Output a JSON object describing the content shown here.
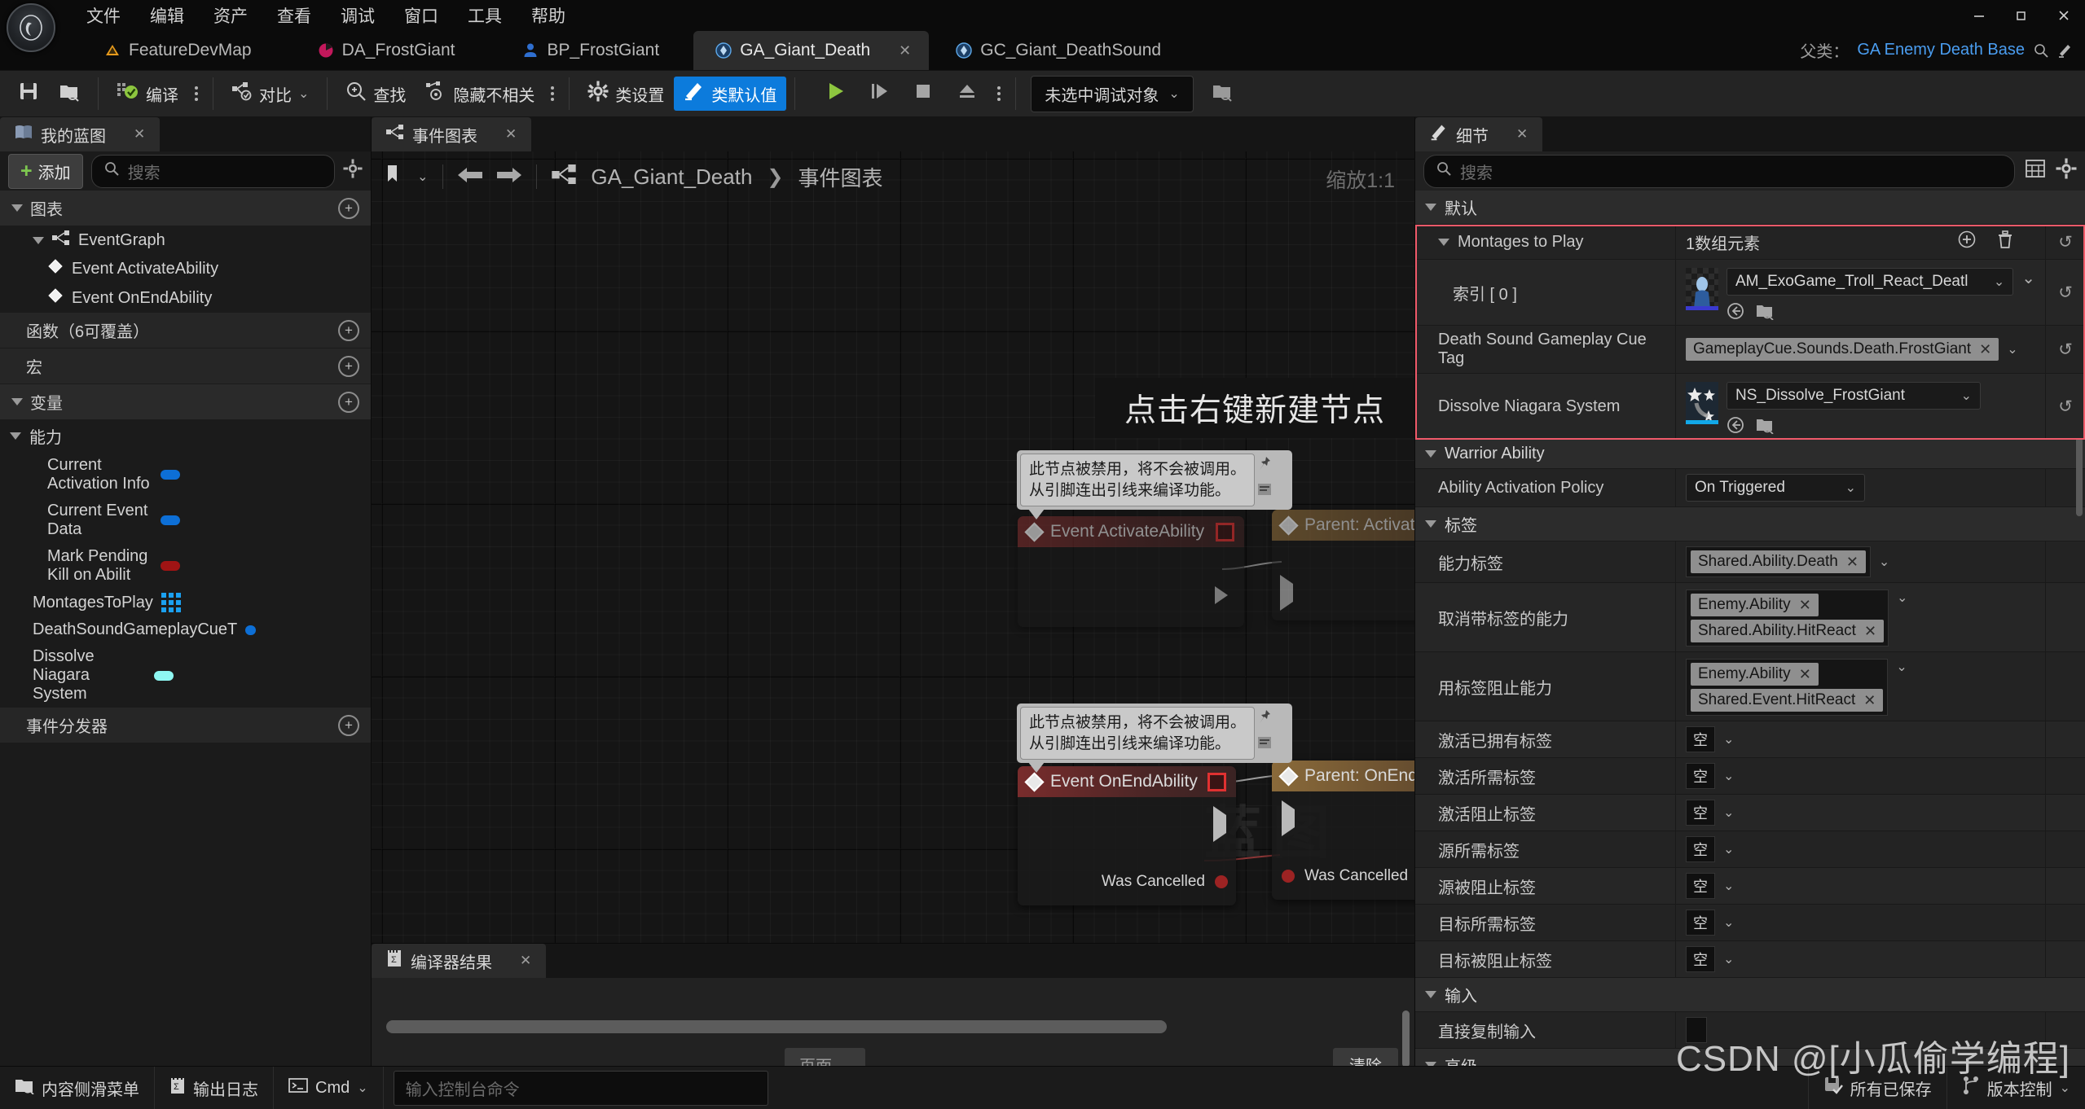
{
  "menu": {
    "items": [
      "文件",
      "编辑",
      "资产",
      "查看",
      "调试",
      "窗口",
      "工具",
      "帮助"
    ],
    "window_minimize": "—",
    "window_restore": "❐",
    "window_close": "✕"
  },
  "tabs": [
    {
      "label": "FeatureDevMap",
      "icon": "level-icon",
      "active": false,
      "closable": false
    },
    {
      "label": "DA_FrostGiant",
      "icon": "dataasset-icon",
      "active": false,
      "closable": false
    },
    {
      "label": "BP_FrostGiant",
      "icon": "blueprint-icon",
      "active": false,
      "closable": false
    },
    {
      "label": "GA_Giant_Death",
      "icon": "gameplayability-icon",
      "active": true,
      "closable": true,
      "close_label": "✕"
    },
    {
      "label": "GC_Giant_DeathSound",
      "icon": "gameplaycue-icon",
      "active": false,
      "closable": false
    }
  ],
  "parent_class": {
    "label": "父类：",
    "value": "GA Enemy Death Base"
  },
  "toolbar": {
    "save_icon": "save-icon",
    "browse_icon": "browse-content-icon",
    "compile_label": "编译",
    "diff_label": "对比",
    "find_label": "查找",
    "hide_unrelated_label": "隐藏不相关",
    "class_settings_label": "类设置",
    "class_defaults_label": "类默认值",
    "play_icon": "play-icon",
    "step_icon": "step-icon",
    "stop_icon": "stop-icon",
    "eject_icon": "eject-icon",
    "debug_object": "未选中调试对象"
  },
  "my_blueprint": {
    "tab_label": "我的蓝图",
    "tab_close": "✕",
    "add_label": "添加",
    "search_placeholder": "搜索",
    "settings_icon": "gear-icon",
    "sections": [
      {
        "name": "图表",
        "has_add": true,
        "items": [
          {
            "label": "EventGraph",
            "type": "graph",
            "depth": 0
          },
          {
            "label": "Event ActivateAbility",
            "type": "event",
            "depth": 1
          },
          {
            "label": "Event OnEndAbility",
            "type": "event",
            "depth": 1
          }
        ]
      },
      {
        "name": "函数（6可覆盖）",
        "has_add": true,
        "items": []
      },
      {
        "name": "宏",
        "has_add": true,
        "items": []
      },
      {
        "name": "变量",
        "has_add": true,
        "subgroup": "能力",
        "items": [
          {
            "label": "Current Activation Info",
            "pin": "#0d6fd6",
            "kind": "pill",
            "depth": 2
          },
          {
            "label": "Current Event Data",
            "pin": "#0d6fd6",
            "kind": "pill",
            "depth": 2
          },
          {
            "label": "Mark Pending Kill on Abilit",
            "pin": "#a01414",
            "kind": "pill",
            "depth": 2
          },
          {
            "label": "MontagesToPlay",
            "pin": "#1ba0f0",
            "kind": "array",
            "depth": 1
          },
          {
            "label": "DeathSoundGameplayCueT",
            "pin": "#0d6fd6",
            "kind": "pill",
            "depth": 1
          },
          {
            "label": "Dissolve Niagara System",
            "pin": "#8ef7f2",
            "kind": "pill",
            "depth": 1
          }
        ]
      },
      {
        "name": "事件分发器",
        "has_add": true,
        "items": []
      }
    ]
  },
  "graph": {
    "tab_label": "事件图表",
    "tab_close": "✕",
    "breadcrumb": [
      "GA_Giant_Death",
      "事件图表"
    ],
    "breadcrumb_sep": "❯",
    "zoom_label": "缩放1:1",
    "watermark": "蓝图",
    "hint_banner": "点击右键新建节点",
    "comment_text": "此节点被禁用，将不会被调用。\n从引脚连出引线来编译功能。",
    "nodes": [
      {
        "title": "Event ActivateAbility",
        "kind": "event",
        "disabled": true
      },
      {
        "title": "Parent: ActivateAbility",
        "kind": "parent",
        "disabled": true
      },
      {
        "title": "Event OnEndAbility",
        "kind": "event",
        "disabled": false,
        "out_pin": "Was Cancelled"
      },
      {
        "title": "Parent: OnEndAbility",
        "kind": "parent",
        "disabled": false,
        "in_pin": "Was Cancelled"
      }
    ]
  },
  "compiler": {
    "tab_label": "编译器结果",
    "tab_close": "✕",
    "page_label": "页面",
    "clear_label": "清除"
  },
  "details": {
    "tab_label": "细节",
    "tab_close": "✕",
    "search_placeholder": "搜索",
    "grid_icon": "column-view-icon",
    "settings_icon": "gear-icon",
    "categories": [
      {
        "name": "默认",
        "rows": [
          {
            "label": "Montages to Play",
            "type": "array-header",
            "value": "1数组元素",
            "add_icon": "plus-circle-icon",
            "delete_icon": "trash-icon",
            "reset": "↺",
            "expandable": true
          },
          {
            "label": "索引 [ 0 ]",
            "type": "asset",
            "value": "AM_ExoGame_Troll_React_Deatl",
            "thumb_bar": "#3a3ad0",
            "indent": true,
            "reset": "↺",
            "extra_chevron": "⌄"
          },
          {
            "label": "Death Sound Gameplay Cue Tag",
            "type": "tag",
            "tags": [
              "GameplayCue.Sounds.Death.FrostGiant"
            ],
            "reset": "↺"
          },
          {
            "label": "Dissolve Niagara System",
            "type": "asset",
            "value": "NS_Dissolve_FrostGiant",
            "thumb_bar": "#12a8e8",
            "thumb_icon": "niagara-stars-icon",
            "reset": "↺"
          }
        ]
      },
      {
        "name": "Warrior Ability",
        "rows": [
          {
            "label": "Ability Activation Policy",
            "type": "select",
            "value": "On Triggered"
          }
        ]
      },
      {
        "name": "标签",
        "rows": [
          {
            "label": "能力标签",
            "type": "tag",
            "tags": [
              "Shared.Ability.Death"
            ]
          },
          {
            "label": "取消带标签的能力",
            "type": "tag",
            "tags": [
              "Enemy.Ability",
              "Shared.Ability.HitReact"
            ]
          },
          {
            "label": "用标签阻止能力",
            "type": "tag",
            "tags": [
              "Enemy.Ability",
              "Shared.Event.HitReact"
            ]
          },
          {
            "label": "激活已拥有标签",
            "type": "empty",
            "value": "空"
          },
          {
            "label": "激活所需标签",
            "type": "empty",
            "value": "空"
          },
          {
            "label": "激活阻止标签",
            "type": "empty",
            "value": "空"
          },
          {
            "label": "源所需标签",
            "type": "empty",
            "value": "空"
          },
          {
            "label": "源被阻止标签",
            "type": "empty",
            "value": "空"
          },
          {
            "label": "目标所需标签",
            "type": "empty",
            "value": "空"
          },
          {
            "label": "目标被阻止标签",
            "type": "empty",
            "value": "空"
          }
        ]
      },
      {
        "name": "输入",
        "rows": [
          {
            "label": "直接复制输入",
            "type": "checkbox"
          }
        ]
      },
      {
        "name": "高级",
        "rows": []
      }
    ]
  },
  "statusbar": {
    "content_drawer": "内容侧滑菜单",
    "output_log": "输出日志",
    "cmd_label": "Cmd",
    "cmd_placeholder": "输入控制台命令",
    "all_saved": "所有已保存",
    "source_control": "版本控制"
  },
  "watermark": "CSDN @[小瓜偷学编程]",
  "colors": {
    "accent_blue": "#0c7bdc",
    "link_blue": "#4a9df0",
    "highlight_red": "#f05a6a",
    "green": "#7ec850"
  }
}
